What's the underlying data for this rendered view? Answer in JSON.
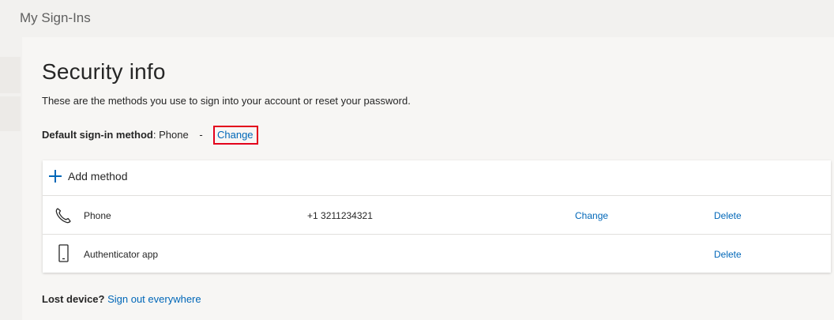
{
  "header": {
    "app_title": "My Sign-Ins"
  },
  "page": {
    "title": "Security info",
    "description": "These are the methods you use to sign into your account or reset your password."
  },
  "default_method": {
    "label": "Default sign-in method",
    "colon": ":",
    "value": "Phone",
    "separator": "-",
    "change_label": "Change"
  },
  "methods_card": {
    "add_label": "Add method",
    "rows": [
      {
        "icon": "phone-icon",
        "name": "Phone",
        "value": "+1 3211234321",
        "change_label": "Change",
        "delete_label": "Delete"
      },
      {
        "icon": "mobile-device-icon",
        "name": "Authenticator app",
        "value": "",
        "change_label": "",
        "delete_label": "Delete"
      }
    ]
  },
  "lost_device": {
    "label": "Lost device?",
    "link": "Sign out everywhere"
  },
  "colors": {
    "link": "#0067b8",
    "highlight": "#e3001b",
    "background": "#f2f1ef"
  }
}
